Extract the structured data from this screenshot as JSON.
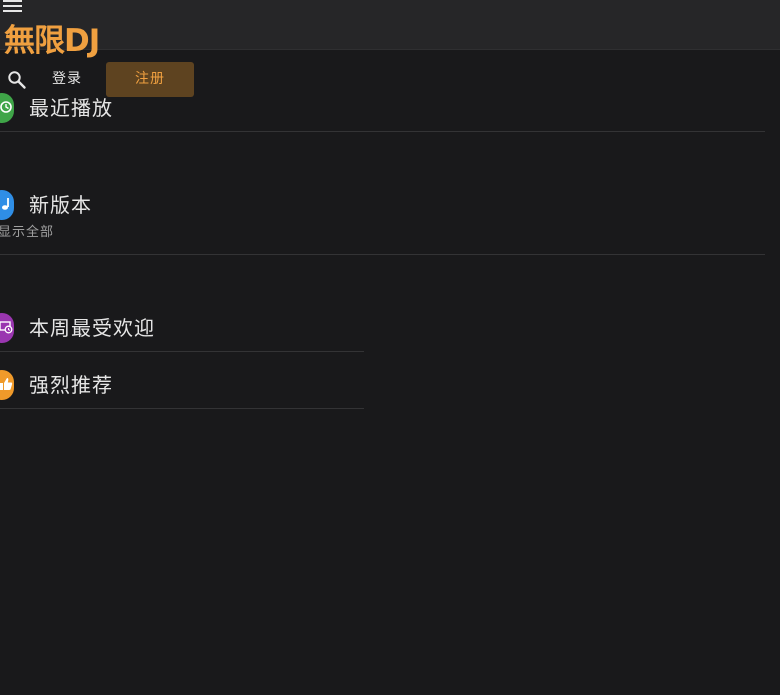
{
  "header": {
    "logo_text": "無限DJ",
    "login_label": "登录",
    "register_label": "注册"
  },
  "sections": [
    {
      "title": "最近播放",
      "icon": "history-icon",
      "color": "#3fa548"
    },
    {
      "title": "新版本",
      "subtitle": "显示全部",
      "icon": "music-note-icon",
      "color": "#2f8ee6"
    },
    {
      "title": "本周最受欢迎",
      "icon": "weekly-calendar-icon",
      "color": "#9a36b0"
    },
    {
      "title": "强烈推荐",
      "icon": "thumbs-up-icon",
      "color": "#f09a2a"
    }
  ],
  "colors": {
    "background": "#19191b",
    "header": "#262628",
    "accent": "#f0a040",
    "register_bg": "#5e4320"
  }
}
